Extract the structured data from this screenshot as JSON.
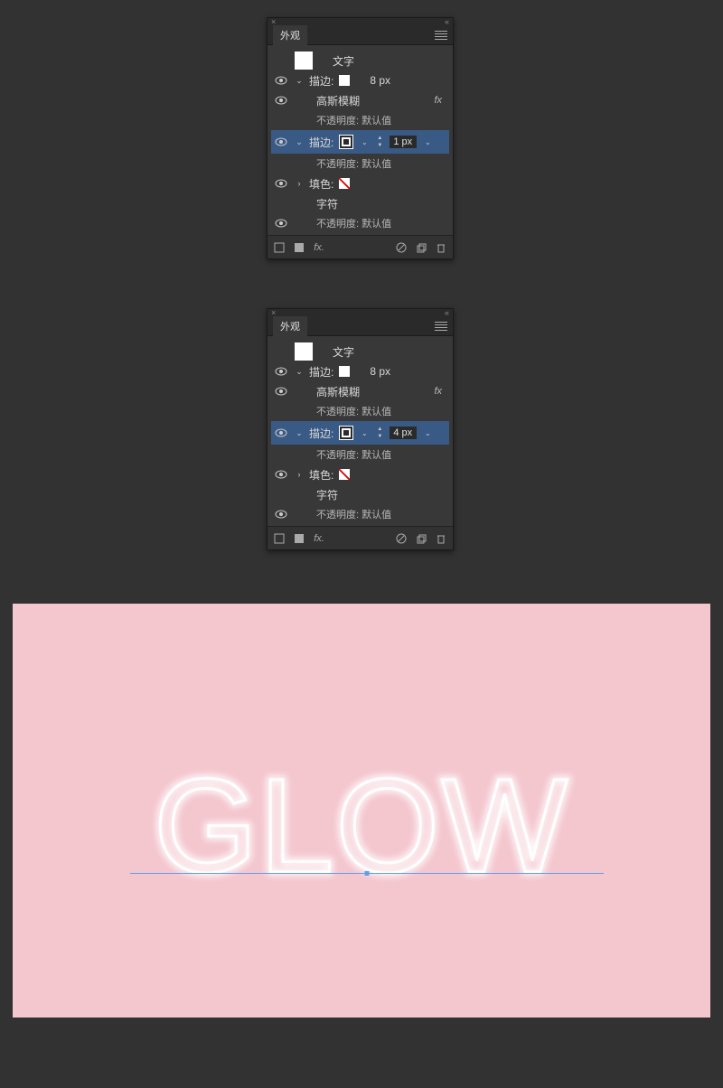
{
  "panel": {
    "title": "外观",
    "type_label": "文字",
    "char_label": "字符",
    "stroke_label": "描边:",
    "fill_label": "填色:",
    "blur_label": "高斯模糊",
    "opacity_label": "不透明度: 默认值",
    "fx_label": "fx"
  },
  "panel1": {
    "stroke1_value": "8 px",
    "stroke2_value": "1 px"
  },
  "panel2": {
    "stroke1_value": "8 px",
    "stroke2_value": "4 px"
  },
  "canvas": {
    "text": "GLOW",
    "bg": "#f4c6ce"
  }
}
